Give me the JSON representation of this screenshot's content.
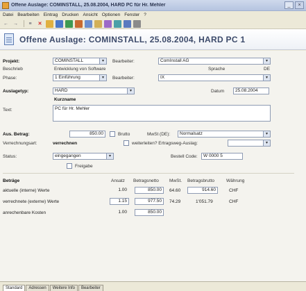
{
  "window": {
    "title": "Offene Auslage: COMINSTALL, 25.08.2004, HARD PC für Hr. Mehler"
  },
  "menu": [
    "Datei",
    "Bearbeiten",
    "Eintrag",
    "Drucken",
    "Ansicht",
    "Optionen",
    "Fenster",
    "?"
  ],
  "toolbar": {
    "icons": [
      "back-arrow-icon",
      "forward-arrow-icon",
      "list-icon",
      "delete-icon",
      "user-icon",
      "table-icon",
      "chart-icon",
      "person-icon",
      "calendar-icon",
      "mail-icon",
      "note-icon",
      "refresh-icon",
      "help-icon",
      "print-icon"
    ]
  },
  "header": {
    "title": "Offene Auslage: COMINSTALL, 25.08.2004, HARD PC 1"
  },
  "form": {
    "projekt_label": "Projekt:",
    "projekt_value": "COMINSTALL",
    "bearbeiter_label": "Bearbeiter:",
    "bearbeiter_value": "ComInstall AG",
    "beschreibung_label": "Beschrieb",
    "beschreibung_value": "Entwicklung von Software",
    "sprache_label": "Sprache",
    "sprache_value": "DE",
    "phase_label": "Phase:",
    "phase_value": "1 Einführung",
    "bearbeiter2_label": "Bearbeiter:",
    "bearbeiter2_value": "IX",
    "auslage_label": "Auslagetyp:",
    "auslage_value": "HARD",
    "datum_label": "Datum",
    "datum_value": "25.08.2004",
    "kurzname_label": "Kurzname",
    "text_label": "Text:",
    "text_value": "PC für Hr. Mehler",
    "betrag_label": "Aus. Betrag:",
    "betrag_value": "850.00",
    "brutto_label": "Brutto",
    "mwst_label": "MwSt (DE):",
    "mwst_value": "Normalsatz",
    "verrechnung_label": "Verrechnungsart:",
    "verrechnung_value": "verrechnen",
    "weiterleiten_label": "weiterleiten? Ertragsweg-Auslag:",
    "status_label": "Status:",
    "status_value": "eingegangen",
    "bestell_label": "Bestell Code:",
    "bestell_value": "W 0000 5",
    "freigabe_label": "Freigabe"
  },
  "table": {
    "headers": [
      "Beträge",
      "Ansatz",
      "Betragsnetto",
      "MwSt.",
      "Betragsbrutto",
      "Währung"
    ],
    "rows": [
      {
        "name": "aktuelle (interne) Werte",
        "ansatz": "1.00",
        "netto": "850.00",
        "mwst": "64.60",
        "brutto": "914.60",
        "waehrung": "CHF"
      },
      {
        "name": "verrechnete (externe) Werte",
        "ansatz": "1.15",
        "netto": "977.50",
        "mwst": "74.29",
        "brutto": "1'051.79",
        "waehrung": "CHF"
      },
      {
        "name": "anrechenbare Kosten",
        "ansatz": "1.00",
        "netto": "850.00",
        "mwst": "",
        "brutto": "",
        "waehrung": ""
      }
    ]
  },
  "tabs": [
    "Standard",
    "Adressen",
    "Weitere Info",
    "Bearbeiter"
  ]
}
